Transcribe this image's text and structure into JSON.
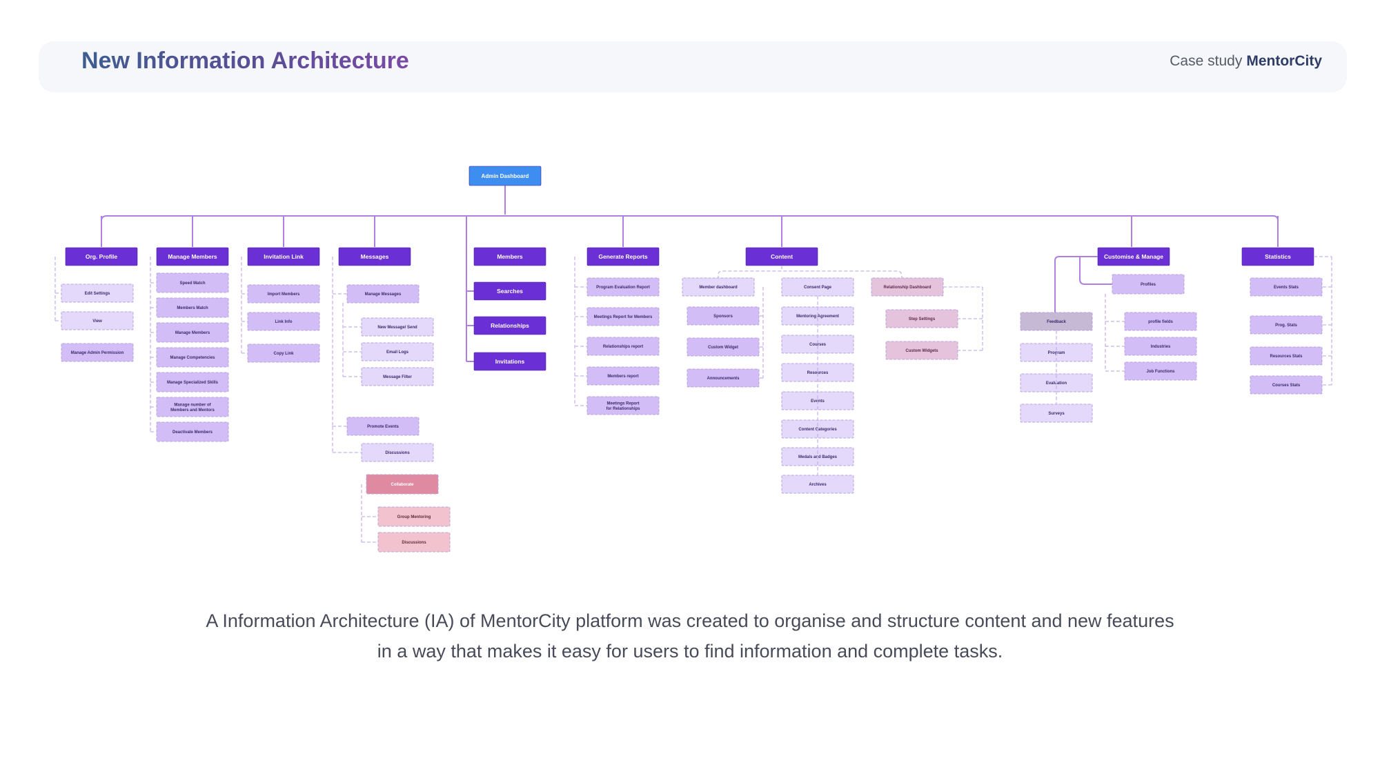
{
  "header": {
    "title": "New Information Architecture",
    "case_label": "Case study",
    "brand": "MentorCity"
  },
  "description": {
    "line1": "A Information Architecture (IA) of MentorCity platform was created to organise and structure content and new features",
    "line2": "in a way that makes it easy for users to find information and complete tasks."
  },
  "colors": {
    "root": "#3d8ef0",
    "section": "#6b2fd6",
    "child": "#e4d9fa",
    "child_strong": "#d2bdf6",
    "collab": "#e08aa2",
    "collab_child": "#f2c3cf",
    "pink_child": "#e6c3dc",
    "feedback": "#c5b9d6",
    "connector": "#b07ee0"
  },
  "tree": {
    "root": "Admin Dashboard",
    "org_profile": {
      "label": "Org. Profile",
      "children": [
        "Edit Settings",
        "View",
        "Manage Admin Permission"
      ]
    },
    "manage_members": {
      "label": "Manage Members",
      "children": [
        "Speed Match",
        "Members Match",
        "Manage Members",
        "Manage Competencies",
        "Manage Specialized Skills",
        "Manage number of Members and Mentors",
        "Deactivate Members"
      ]
    },
    "invitation_link": {
      "label": "Invitation Link",
      "children": [
        "Import Members",
        "Link Info",
        "Copy Link"
      ]
    },
    "messages": {
      "label": "Messages",
      "manage_messages": "Manage Messages",
      "manage_children": [
        "New Message/ Send",
        "Email Logs",
        "Message Filter"
      ],
      "promote_events": "Promote Events",
      "discussions": "Discussions",
      "collaborate": "Collaborate",
      "collab_children": [
        "Group Mentoring",
        "Discussions"
      ]
    },
    "members_group": [
      "Members",
      "Searches",
      "Relationships",
      "Invitations"
    ],
    "generate_reports": {
      "label": "Generate Reports",
      "children": [
        "Program Evaluation Report",
        "Meetings Report for Members",
        "Relationships report",
        "Members report",
        "Meetings Report for Relationships"
      ]
    },
    "content": {
      "label": "Content",
      "member_dashboard": "Member dashboard",
      "member_children": [
        "Sponsors",
        "Custom Widget",
        "Announcements"
      ],
      "consent_page": "Consent Page",
      "consent_children": [
        "Mentoring Agreement",
        "Courses",
        "Resources",
        "Events",
        "Content Categories",
        "Medals and Badges",
        "Archives"
      ],
      "relationship_dashboard": "Relationship Dashboard",
      "relationship_children": [
        "Step Settings",
        "Custom Widgets"
      ]
    },
    "customise": {
      "label": "Customise & Manage",
      "feedback": "Feedback",
      "feedback_children": [
        "Program",
        "Evaluation",
        "Surveys"
      ],
      "profiles": "Profiles",
      "profiles_children": [
        "profile fields",
        "Industries",
        "Job Functions"
      ]
    },
    "statistics": {
      "label": "Statistics",
      "children": [
        "Events Stats",
        "Prog. Stats",
        "Resources Stats",
        "Courses Stats"
      ]
    }
  }
}
